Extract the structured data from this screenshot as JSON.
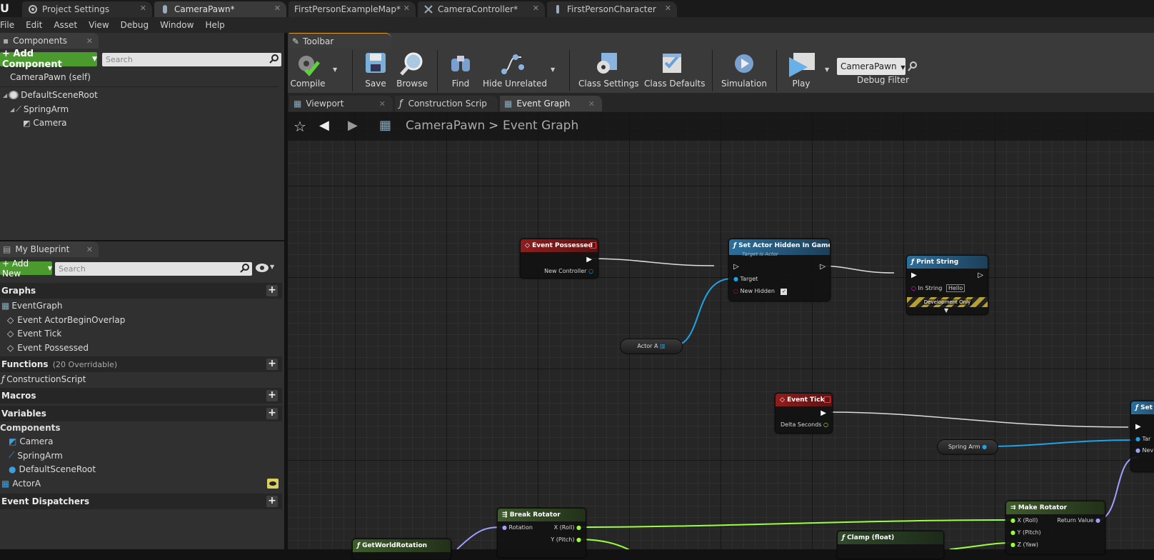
{
  "document_tabs": [
    {
      "label": "Project Settings",
      "active": false
    },
    {
      "label": "CameraPawn*",
      "active": true
    },
    {
      "label": "FirstPersonExampleMap*",
      "active": false
    },
    {
      "label": "CameraController*",
      "active": false
    },
    {
      "label": "FirstPersonCharacter",
      "active": false
    }
  ],
  "menu": [
    "File",
    "Edit",
    "Asset",
    "View",
    "Debug",
    "Window",
    "Help"
  ],
  "components_panel": {
    "title": "Components",
    "add_button": "+ Add Component",
    "search_placeholder": "Search",
    "self_label": "CameraPawn (self)",
    "tree": [
      "DefaultSceneRoot",
      "SpringArm",
      "Camera"
    ]
  },
  "my_blueprint": {
    "title": "My Blueprint",
    "add_button": "+ Add New",
    "search_placeholder": "Search",
    "graphs_header": "Graphs",
    "graph_name": "EventGraph",
    "events": [
      "Event ActorBeginOverlap",
      "Event Tick",
      "Event Possessed"
    ],
    "functions_header": "Functions",
    "functions_note": "(20 Overridable)",
    "functions": [
      "ConstructionScript"
    ],
    "macros_header": "Macros",
    "variables_header": "Variables",
    "components_subheader": "Components",
    "component_vars": [
      "Camera",
      "SpringArm",
      "DefaultSceneRoot"
    ],
    "actor_var": "ActorA",
    "dispatchers_header": "Event Dispatchers"
  },
  "toolbar": {
    "title": "Toolbar",
    "compile": "Compile",
    "save": "Save",
    "browse": "Browse",
    "find": "Find",
    "hide_unrelated": "Hide Unrelated",
    "class_settings": "Class Settings",
    "class_defaults": "Class Defaults",
    "simulation": "Simulation",
    "play": "Play",
    "debug_object": "CameraPawn",
    "debug_filter": "Debug Filter"
  },
  "graph_tabs": [
    "Viewport",
    "Construction Scrip",
    "Event Graph"
  ],
  "breadcrumb": {
    "root": "CameraPawn",
    "separator": ">",
    "leaf": "Event Graph"
  },
  "nodes": {
    "event_possessed": {
      "title": "Event Possessed",
      "pin_out": "New Controller"
    },
    "set_actor_hidden": {
      "title": "Set Actor Hidden In Game",
      "subtitle": "Target is Actor",
      "pin_target": "Target",
      "pin_hidden": "New Hidden"
    },
    "print_string": {
      "title": "Print String",
      "pin_in": "In String",
      "in_value": "Hello",
      "footer": "Development Only"
    },
    "actor_a": {
      "title": "Actor A"
    },
    "event_tick": {
      "title": "Event Tick",
      "pin_out": "Delta Seconds"
    },
    "spring_arm": {
      "title": "Spring Arm"
    },
    "set_partial": {
      "title": "Set",
      "pin_a": "Tar",
      "pin_b": "Nev"
    },
    "break_rotator": {
      "title": "Break Rotator",
      "pin_in": "Rotation",
      "pin_x": "X (Roll)",
      "pin_y": "Y (Pitch)"
    },
    "make_rotator": {
      "title": "Make Rotator",
      "pin_x": "X (Roll)",
      "pin_y": "Y (Pitch)",
      "pin_z": "Z (Yaw)",
      "pin_out": "Return Value"
    },
    "clamp": {
      "title": "Clamp (float)"
    },
    "get_world_rotation": {
      "title": "GetWorldRotation"
    }
  },
  "colors": {
    "accent_green": "#4a9a2e",
    "event_red": "#8e1d1d",
    "function_blue": "#2c6f9b",
    "struct_green": "#3e5c2c",
    "exec_white": "#ffffff",
    "object_blue": "#1da3e8",
    "float_green": "#9bff3d"
  }
}
